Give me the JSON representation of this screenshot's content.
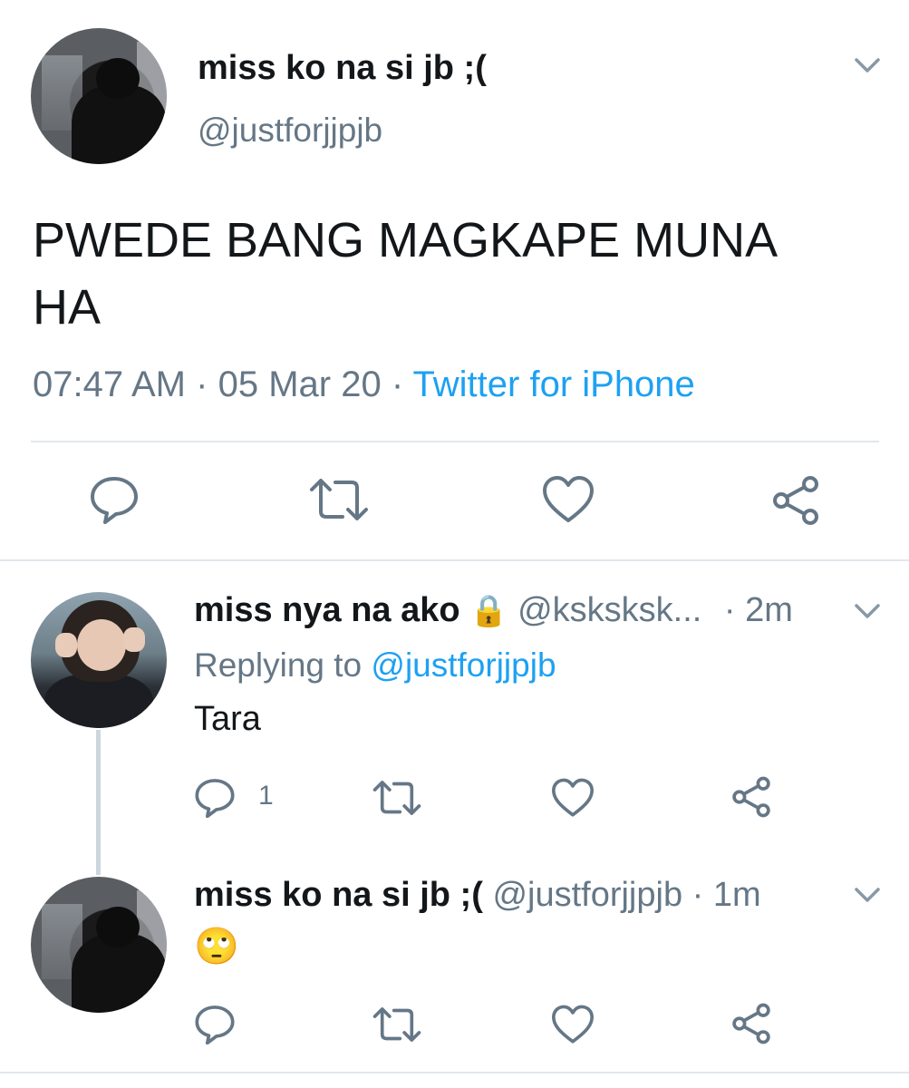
{
  "main_tweet": {
    "display_name": "miss ko na si jb ;(",
    "handle": "@justforjjpjb",
    "text_line1": "PWEDE BANG MAGKAPE MUNA",
    "text_line2": "HA",
    "time": "07:47 AM",
    "sep1": "·",
    "date": "05 Mar 20",
    "sep2": "·",
    "source": "Twitter for iPhone",
    "actions": [
      "reply-icon",
      "retweet-icon",
      "like-icon",
      "share-icon"
    ]
  },
  "reply1": {
    "display_name": "miss nya na ako",
    "lock": "🔒",
    "handle": "@ksksksk...",
    "time": "· 2m",
    "replying_prefix": "Replying to",
    "replying_handle": "@justforjjpjb",
    "text": "Tara",
    "reply_count": "1"
  },
  "reply2": {
    "display_name": "miss ko na si jb ;(",
    "handle": "@justforjjpjb",
    "time": "· 1m",
    "text": "🙄"
  },
  "colors": {
    "link": "#1da1f2",
    "muted": "#657786",
    "text": "#14171a",
    "divider": "#e1e8ed"
  }
}
